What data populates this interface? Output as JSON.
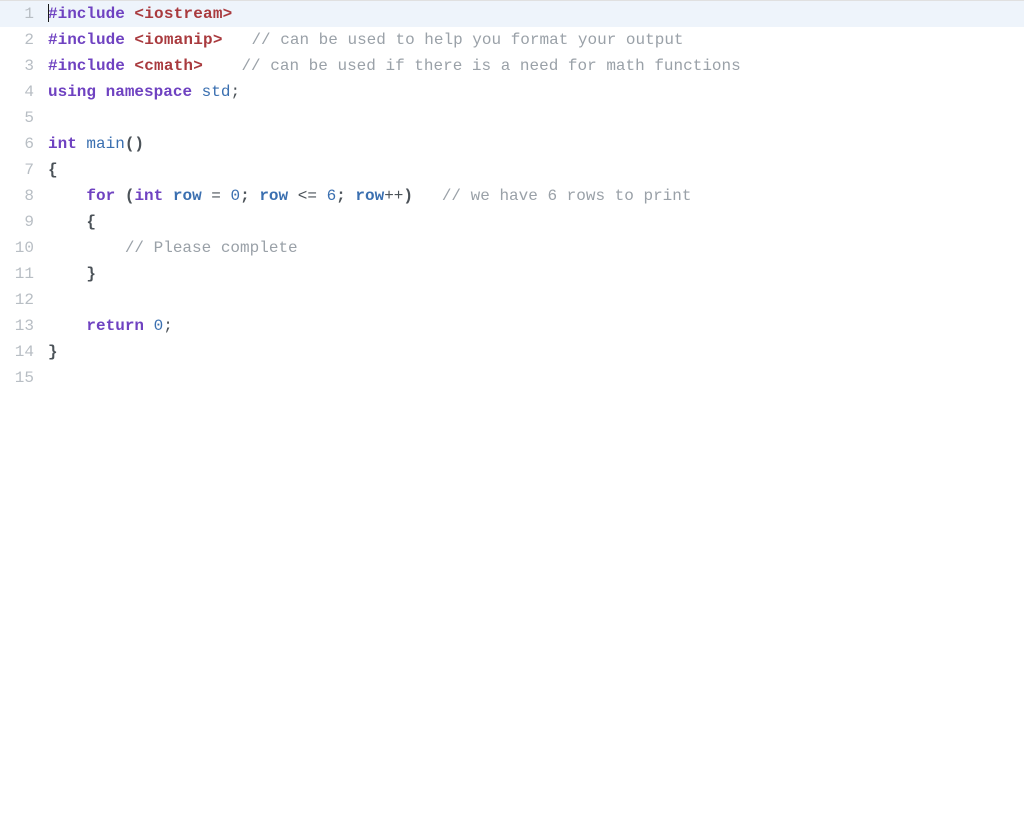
{
  "editor": {
    "highlighted_line": 1,
    "cursor_line": 1,
    "lines": [
      {
        "n": 1,
        "tokens": [
          {
            "cls": "tok-preproc",
            "t": "#include"
          },
          {
            "cls": "tok-plain",
            "t": " "
          },
          {
            "cls": "tok-include-str",
            "t": "<iostream>"
          }
        ]
      },
      {
        "n": 2,
        "tokens": [
          {
            "cls": "tok-preproc",
            "t": "#include"
          },
          {
            "cls": "tok-plain",
            "t": " "
          },
          {
            "cls": "tok-include-str",
            "t": "<iomanip>"
          },
          {
            "cls": "tok-plain",
            "t": "   "
          },
          {
            "cls": "tok-comment",
            "t": "// can be used to help you format your output"
          }
        ]
      },
      {
        "n": 3,
        "tokens": [
          {
            "cls": "tok-preproc",
            "t": "#include"
          },
          {
            "cls": "tok-plain",
            "t": " "
          },
          {
            "cls": "tok-include-str",
            "t": "<cmath>"
          },
          {
            "cls": "tok-plain",
            "t": "    "
          },
          {
            "cls": "tok-comment",
            "t": "// can be used if there is a need for math functions"
          }
        ]
      },
      {
        "n": 4,
        "tokens": [
          {
            "cls": "tok-keyword",
            "t": "using"
          },
          {
            "cls": "tok-plain",
            "t": " "
          },
          {
            "cls": "tok-keyword",
            "t": "namespace"
          },
          {
            "cls": "tok-plain",
            "t": " "
          },
          {
            "cls": "tok-namespace",
            "t": "std"
          },
          {
            "cls": "tok-punct",
            "t": ";"
          }
        ]
      },
      {
        "n": 5,
        "tokens": []
      },
      {
        "n": 6,
        "tokens": [
          {
            "cls": "tok-type",
            "t": "int"
          },
          {
            "cls": "tok-plain",
            "t": " "
          },
          {
            "cls": "tok-func",
            "t": "main"
          },
          {
            "cls": "tok-punct-bold",
            "t": "()"
          }
        ]
      },
      {
        "n": 7,
        "tokens": [
          {
            "cls": "tok-punct-bold",
            "t": "{"
          }
        ]
      },
      {
        "n": 8,
        "tokens": [
          {
            "cls": "tok-plain",
            "t": "    "
          },
          {
            "cls": "tok-keyword",
            "t": "for"
          },
          {
            "cls": "tok-plain",
            "t": " "
          },
          {
            "cls": "tok-punct-bold",
            "t": "("
          },
          {
            "cls": "tok-type",
            "t": "int"
          },
          {
            "cls": "tok-plain",
            "t": " "
          },
          {
            "cls": "tok-ident-bold",
            "t": "row"
          },
          {
            "cls": "tok-plain",
            "t": " "
          },
          {
            "cls": "tok-op",
            "t": "="
          },
          {
            "cls": "tok-plain",
            "t": " "
          },
          {
            "cls": "tok-num",
            "t": "0"
          },
          {
            "cls": "tok-punct-bold",
            "t": ";"
          },
          {
            "cls": "tok-plain",
            "t": " "
          },
          {
            "cls": "tok-ident-bold",
            "t": "row"
          },
          {
            "cls": "tok-plain",
            "t": " "
          },
          {
            "cls": "tok-op",
            "t": "<="
          },
          {
            "cls": "tok-plain",
            "t": " "
          },
          {
            "cls": "tok-num",
            "t": "6"
          },
          {
            "cls": "tok-punct-bold",
            "t": ";"
          },
          {
            "cls": "tok-plain",
            "t": " "
          },
          {
            "cls": "tok-ident-bold",
            "t": "row"
          },
          {
            "cls": "tok-op",
            "t": "++"
          },
          {
            "cls": "tok-punct-bold",
            "t": ")"
          },
          {
            "cls": "tok-plain",
            "t": "   "
          },
          {
            "cls": "tok-comment",
            "t": "// we have 6 rows to print"
          }
        ]
      },
      {
        "n": 9,
        "tokens": [
          {
            "cls": "tok-plain",
            "t": "    "
          },
          {
            "cls": "tok-punct-bold",
            "t": "{"
          }
        ]
      },
      {
        "n": 10,
        "tokens": [
          {
            "cls": "tok-plain",
            "t": "        "
          },
          {
            "cls": "tok-comment",
            "t": "// Please complete"
          }
        ]
      },
      {
        "n": 11,
        "tokens": [
          {
            "cls": "tok-plain",
            "t": "    "
          },
          {
            "cls": "tok-punct-bold",
            "t": "}"
          }
        ]
      },
      {
        "n": 12,
        "tokens": []
      },
      {
        "n": 13,
        "tokens": [
          {
            "cls": "tok-plain",
            "t": "    "
          },
          {
            "cls": "tok-keyword",
            "t": "return"
          },
          {
            "cls": "tok-plain",
            "t": " "
          },
          {
            "cls": "tok-num",
            "t": "0"
          },
          {
            "cls": "tok-punct",
            "t": ";"
          }
        ]
      },
      {
        "n": 14,
        "tokens": [
          {
            "cls": "tok-punct-bold",
            "t": "}"
          }
        ]
      },
      {
        "n": 15,
        "tokens": []
      }
    ]
  }
}
